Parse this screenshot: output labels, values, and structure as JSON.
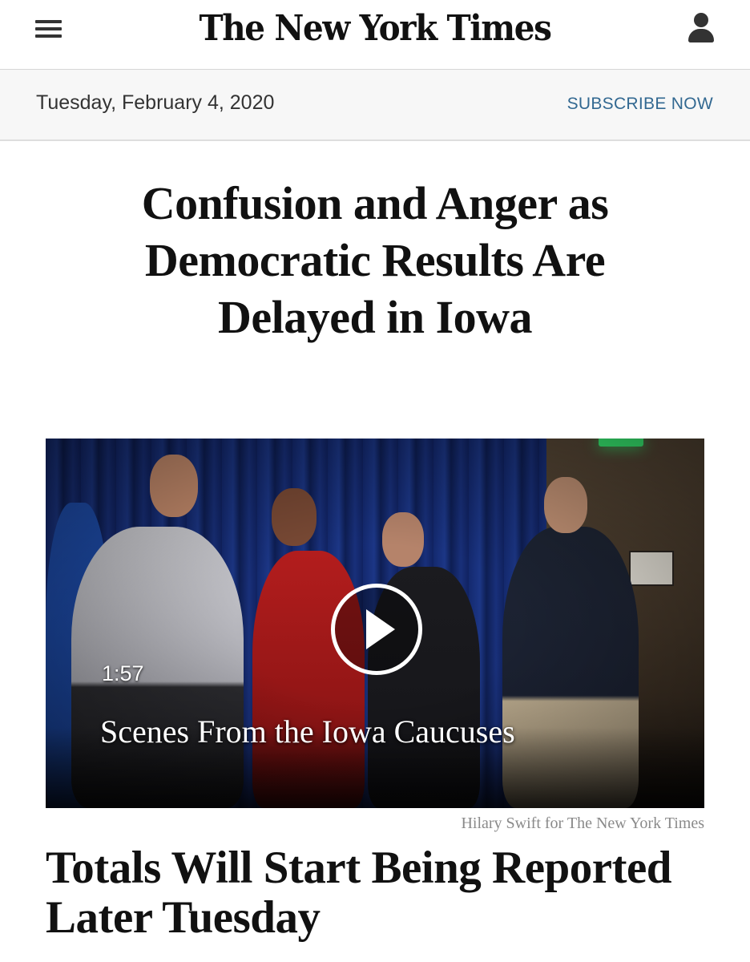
{
  "masthead": {
    "menu_icon": "hamburger-menu-icon",
    "logo": "The New York Times",
    "account_icon": "account-person-icon"
  },
  "datebar": {
    "date": "Tuesday, February 4, 2020",
    "subscribe_label": "SUBSCRIBE NOW",
    "subscribe_color": "#326891"
  },
  "article": {
    "headline": "Confusion and Anger as Democratic Results Are Delayed in Iowa",
    "video": {
      "duration": "1:57",
      "title": "Scenes From the Iowa Caucuses",
      "play_icon": "play-icon"
    },
    "photo_credit": "Hilary Swift for The New York Times",
    "subheadline": "Totals Will Start Being Reported Later Tuesday"
  }
}
